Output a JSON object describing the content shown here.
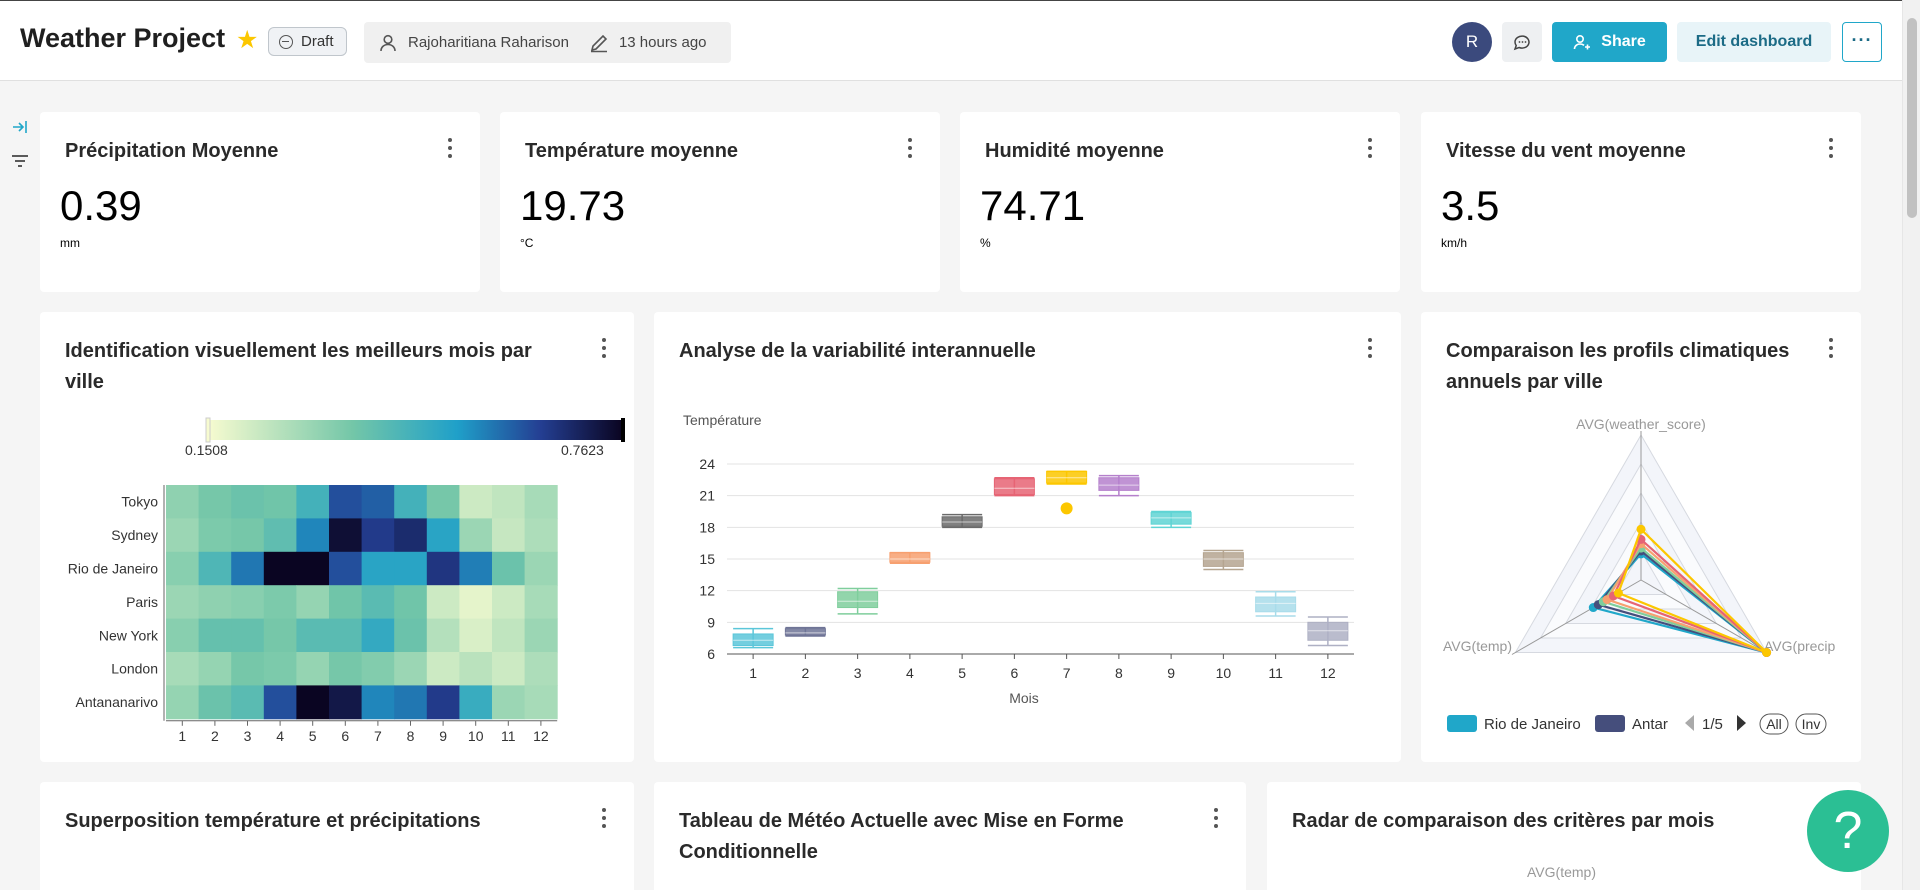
{
  "header": {
    "title": "Weather Project",
    "status": "Draft",
    "owner": "Rajoharitiana Raharison",
    "modified": "13 hours ago",
    "avatar_initial": "R",
    "share_label": "Share",
    "edit_label": "Edit dashboard",
    "more_label": "···"
  },
  "kpis": [
    {
      "title": "Précipitation Moyenne",
      "value": "0.39",
      "unit": "mm"
    },
    {
      "title": "Température moyenne",
      "value": "19.73",
      "unit": "°C"
    },
    {
      "title": "Humidité moyenne",
      "value": "74.71",
      "unit": "%"
    },
    {
      "title": "Vitesse du vent moyenne",
      "value": "3.5",
      "unit": "km/h"
    }
  ],
  "heatmap": {
    "title": "Identification visuellement les meilleurs mois par ville",
    "min_label": "0.1508",
    "max_label": "0.7623",
    "rows": [
      "Tokyo",
      "Sydney",
      "Rio de Janeiro",
      "Paris",
      "New York",
      "London",
      "Antananarivo"
    ],
    "cols": [
      "1",
      "2",
      "3",
      "4",
      "5",
      "6",
      "7",
      "8",
      "9",
      "10",
      "11",
      "12"
    ]
  },
  "boxplot": {
    "title": "Analyse de la variabilité interannuelle",
    "ylabel": "Température",
    "xlabel": "Mois"
  },
  "radar": {
    "title": "Comparaison les profils climatiques annuels par ville",
    "axis_top": "AVG(weather_score)",
    "axis_left": "AVG(temp)",
    "axis_right": "AVG(precip",
    "legend": [
      {
        "name": "Rio de Janeiro",
        "color": "#20a7c9"
      },
      {
        "name": "Antar",
        "color": "#454e7c"
      }
    ],
    "page": "1/5",
    "all_label": "All",
    "inv_label": "Inv"
  },
  "bottom_cards": [
    {
      "title": "Superposition température et précipitations"
    },
    {
      "title": "Tableau de Météo Actuelle avec Mise en Forme Conditionnelle"
    },
    {
      "title": "Radar de comparaison des critères par mois",
      "axis_label": "AVG(temp)"
    }
  ],
  "help_label": "?",
  "colors": {
    "accent": "#20a7c9",
    "star": "#fcc700",
    "help": "#2bbf94"
  },
  "chart_data": [
    {
      "type": "heatmap",
      "title": "Identification visuellement les meilleurs mois par ville",
      "categories_x": [
        "1",
        "2",
        "3",
        "4",
        "5",
        "6",
        "7",
        "8",
        "9",
        "10",
        "11",
        "12"
      ],
      "categories_y": [
        "Tokyo",
        "Sydney",
        "Rio de Janeiro",
        "Paris",
        "New York",
        "London",
        "Antananarivo"
      ],
      "range": [
        0.1508,
        0.7623
      ],
      "values": [
        [
          0.32,
          0.36,
          0.38,
          0.37,
          0.45,
          0.62,
          0.6,
          0.45,
          0.36,
          0.22,
          0.24,
          0.28
        ],
        [
          0.3,
          0.35,
          0.36,
          0.4,
          0.55,
          0.74,
          0.65,
          0.68,
          0.5,
          0.3,
          0.23,
          0.27
        ],
        [
          0.33,
          0.43,
          0.57,
          0.76,
          0.76,
          0.62,
          0.5,
          0.5,
          0.66,
          0.56,
          0.38,
          0.3
        ],
        [
          0.3,
          0.32,
          0.33,
          0.35,
          0.31,
          0.37,
          0.41,
          0.37,
          0.22,
          0.18,
          0.22,
          0.28
        ],
        [
          0.33,
          0.39,
          0.39,
          0.36,
          0.41,
          0.41,
          0.48,
          0.38,
          0.26,
          0.2,
          0.24,
          0.3
        ],
        [
          0.28,
          0.31,
          0.36,
          0.35,
          0.31,
          0.36,
          0.34,
          0.3,
          0.22,
          0.25,
          0.22,
          0.27
        ],
        [
          0.31,
          0.38,
          0.41,
          0.62,
          0.76,
          0.72,
          0.55,
          0.57,
          0.65,
          0.47,
          0.3,
          0.28
        ]
      ]
    },
    {
      "type": "boxplot",
      "title": "Analyse de la variabilité interannuelle",
      "xlabel": "Mois",
      "ylabel": "Température",
      "ylim": [
        6,
        24
      ],
      "yticks": [
        6,
        9,
        12,
        15,
        18,
        21,
        24
      ],
      "categories": [
        "1",
        "2",
        "3",
        "4",
        "5",
        "6",
        "7",
        "8",
        "9",
        "10",
        "11",
        "12"
      ],
      "boxes": [
        {
          "min": 6.6,
          "q1": 6.8,
          "median": 7.3,
          "q3": 7.9,
          "max": 8.4,
          "color": "#5bc6d9"
        },
        {
          "min": 7.7,
          "q1": 7.8,
          "median": 8.0,
          "q3": 8.4,
          "max": 8.5,
          "color": "#6f7496"
        },
        {
          "min": 9.8,
          "q1": 10.4,
          "median": 11.0,
          "q3": 11.9,
          "max": 12.2,
          "color": "#7fce9c"
        },
        {
          "min": 14.6,
          "q1": 14.7,
          "median": 15.0,
          "q3": 15.6,
          "max": 15.6,
          "color": "#f7a070"
        },
        {
          "min": 18.0,
          "q1": 18.1,
          "median": 18.5,
          "q3": 19.0,
          "max": 19.2,
          "color": "#6a6a6a"
        },
        {
          "min": 21.0,
          "q1": 21.1,
          "median": 21.7,
          "q3": 22.6,
          "max": 22.7,
          "color": "#e66474"
        },
        {
          "min": 22.1,
          "q1": 22.2,
          "median": 22.7,
          "q3": 23.3,
          "max": 23.3,
          "color": "#fcc700",
          "outlier": 19.8
        },
        {
          "min": 21.0,
          "q1": 21.5,
          "median": 22.0,
          "q3": 22.7,
          "max": 22.9,
          "color": "#b580cc"
        },
        {
          "min": 18.0,
          "q1": 18.3,
          "median": 18.9,
          "q3": 19.4,
          "max": 19.5,
          "color": "#5fd4d4"
        },
        {
          "min": 14.0,
          "q1": 14.3,
          "median": 15.0,
          "q3": 15.6,
          "max": 15.8,
          "color": "#b5a590"
        },
        {
          "min": 9.6,
          "q1": 10.0,
          "median": 10.8,
          "q3": 11.4,
          "max": 11.9,
          "color": "#a8dcea"
        },
        {
          "min": 6.8,
          "q1": 7.3,
          "median": 8.2,
          "q3": 9.0,
          "max": 9.5,
          "color": "#aeb0c4"
        }
      ]
    },
    {
      "type": "radar",
      "title": "Comparaison les profils climatiques annuels par ville",
      "axes": [
        "AVG(weather_score)",
        "AVG(precip",
        "AVG(temp)"
      ],
      "max": 1,
      "series": [
        {
          "name": "Rio de Janeiro",
          "color": "#20a7c9",
          "values": [
            0.18,
            1.0,
            0.38
          ]
        },
        {
          "name": "Antar",
          "color": "#454e7c",
          "values": [
            0.2,
            1.0,
            0.34
          ]
        },
        {
          "color": "#7fce9c",
          "values": [
            0.22,
            1.0,
            0.3
          ]
        },
        {
          "color": "#f7a070",
          "values": [
            0.25,
            1.0,
            0.27
          ]
        },
        {
          "color": "#e66474",
          "values": [
            0.28,
            1.0,
            0.22
          ]
        },
        {
          "color": "#fcc700",
          "values": [
            0.35,
            1.0,
            0.18
          ]
        }
      ]
    }
  ]
}
